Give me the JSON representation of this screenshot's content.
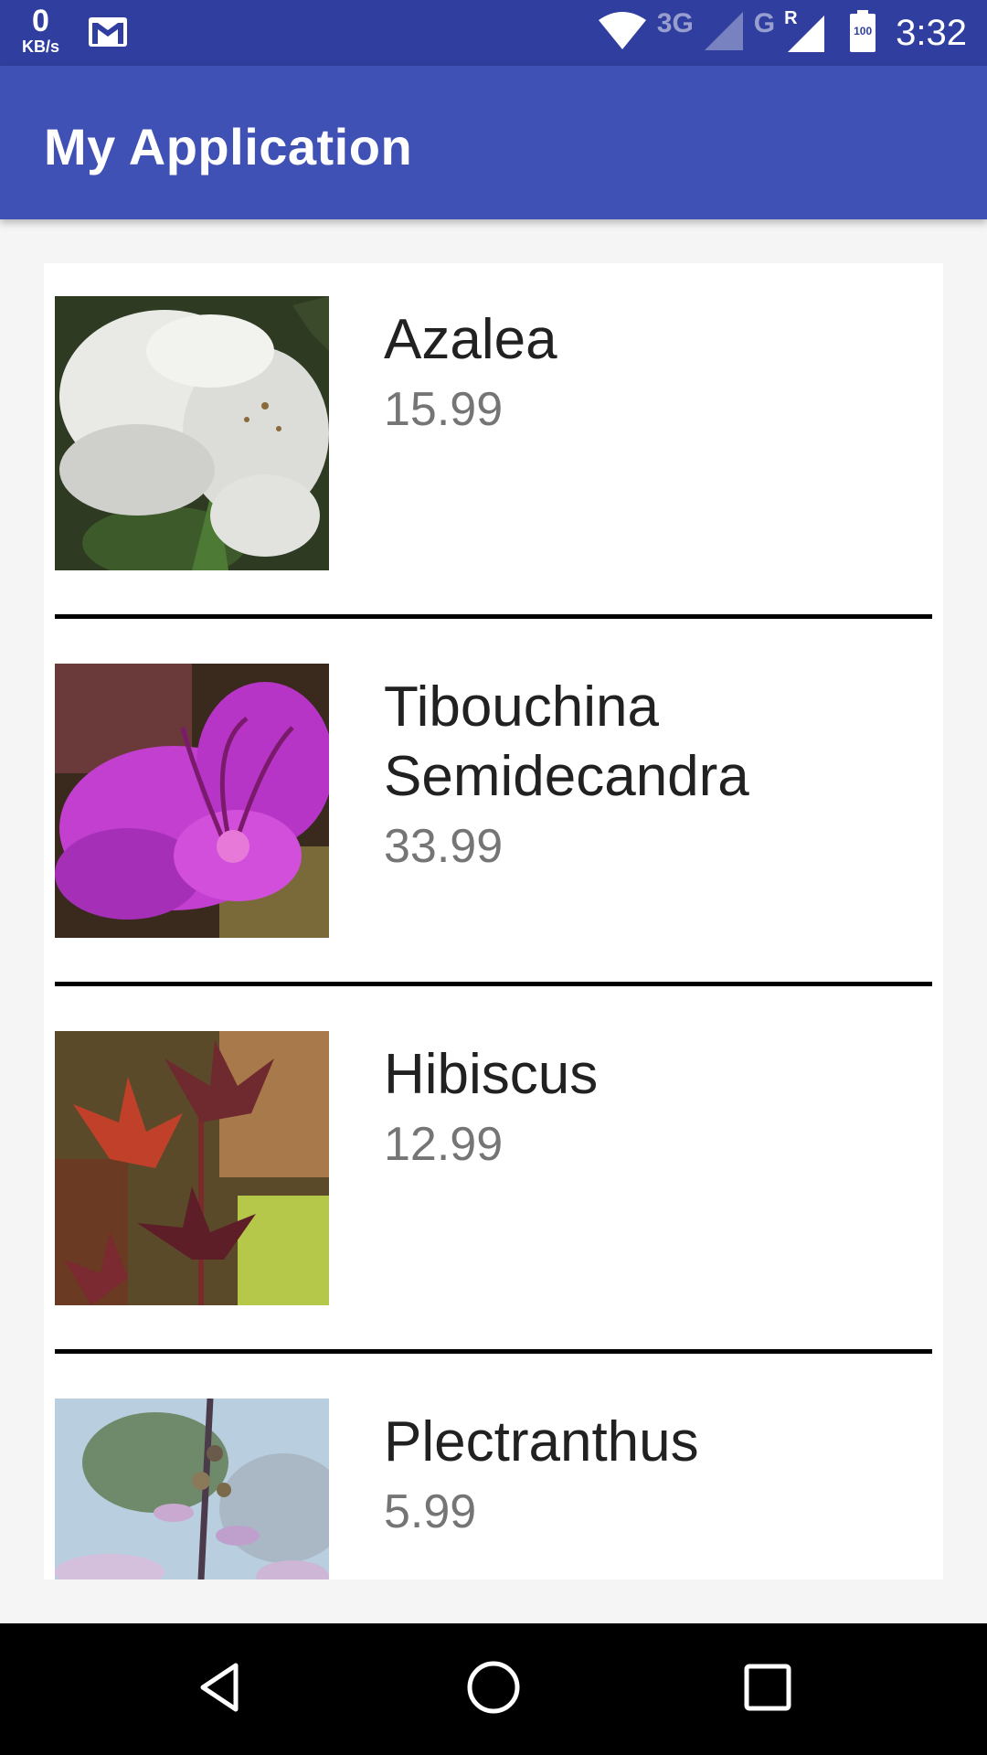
{
  "status_bar": {
    "net_speed_value": "0",
    "net_speed_unit": "KB/s",
    "network_label_1": "3G",
    "network_label_2": "G",
    "roaming_label": "R",
    "battery_level": "100",
    "time": "3:32",
    "icons": [
      "gmail-icon",
      "wifi-icon",
      "signal-icon",
      "battery-icon"
    ]
  },
  "app_bar": {
    "title": "My Application",
    "color": "#3f51b5"
  },
  "plants": [
    {
      "name": "Azalea",
      "price": "15.99"
    },
    {
      "name": "Tibouchina Semidecandra",
      "price": "33.99"
    },
    {
      "name": "Hibiscus",
      "price": "12.99"
    },
    {
      "name": "Plectranthus",
      "price": "5.99"
    }
  ],
  "nav_bar": {
    "icons": [
      "back-icon",
      "home-icon",
      "recents-icon"
    ]
  }
}
